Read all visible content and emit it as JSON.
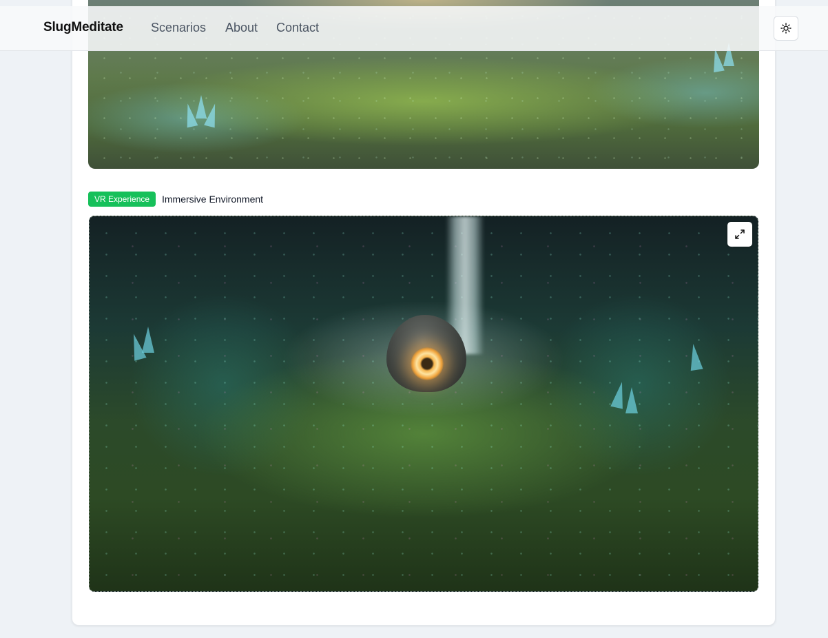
{
  "nav": {
    "brand": "SlugMeditate",
    "links": [
      "Scenarios",
      "About",
      "Contact"
    ],
    "theme_toggle_icon": "sun-icon"
  },
  "experience": {
    "badge": "VR Experience",
    "caption": "Immersive Environment",
    "expand_icon": "expand-icon"
  },
  "colors": {
    "badge_green": "#16c05a",
    "page_background": "#eef2f6",
    "card_background": "#ffffff"
  }
}
